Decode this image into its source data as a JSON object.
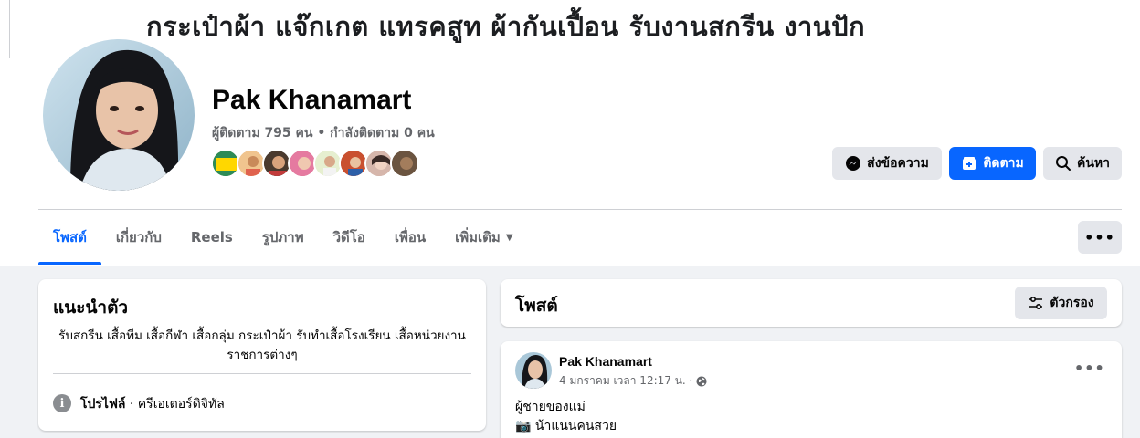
{
  "cover": {
    "banner_text": "กระเป๋าผ้า แจ๊กเกต แทรคสูท ผ้ากันเปื้อน รับงานสกรีน งานปัก"
  },
  "profile": {
    "name": "Pak Khanamart",
    "stats": "ผู้ติดตาม 795 คน • กำลังติดตาม 0 คน"
  },
  "actions": {
    "message_label": "ส่งข้อความ",
    "follow_label": "ติดตาม",
    "search_label": "ค้นหา"
  },
  "tabs": [
    {
      "label": "โพสต์",
      "active": true
    },
    {
      "label": "เกี่ยวกับ"
    },
    {
      "label": "Reels"
    },
    {
      "label": "รูปภาพ"
    },
    {
      "label": "วิดีโอ"
    },
    {
      "label": "เพื่อน"
    },
    {
      "label": "เพิ่มเติม"
    }
  ],
  "intro": {
    "title": "แนะนำตัว",
    "bio": "รับสกรีน เสื้อทีม เสื้อกีฬา เสื้อกลุ่ม กระเป๋าผ้า รับทำเสื้อโรงเรียน เสื้อหน่วยงานราชการต่างๆ",
    "profile_label": "โปรไฟล์",
    "profile_category": " · ครีเอเตอร์ดิจิทัล"
  },
  "posts_header": {
    "title": "โพสต์",
    "filter_label": "ตัวกรอง"
  },
  "post": {
    "author": "Pak Khanamart",
    "time": "4 มกราคม เวลา 12:17 น. ·",
    "line1": "ผู้ชายของแม่",
    "line2": "📷 น้าแนนคนสวย"
  },
  "colors": {
    "accent": "#0866ff",
    "gray_button": "#e4e6eb",
    "page_bg": "#f0f2f5"
  }
}
